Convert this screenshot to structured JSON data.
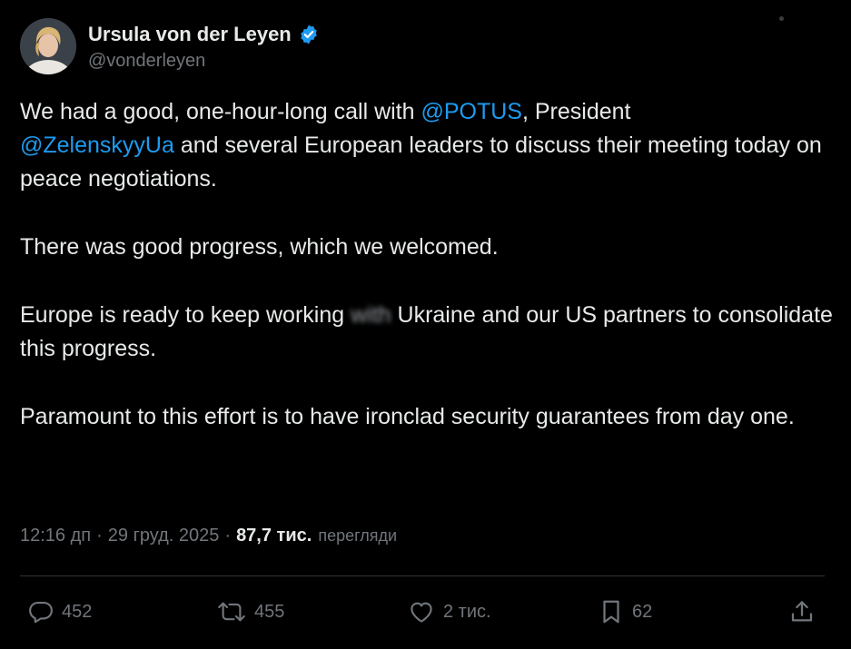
{
  "author": {
    "name": "Ursula von der Leyen",
    "handle": "@vonderleyen",
    "avatar": "avatar-photo",
    "verified_icon": "verified-badge-icon",
    "verified_color": "#1d9bf0"
  },
  "tweet": {
    "p1": {
      "t1": "We had a good, one-hour-long call with ",
      "m1": "@POTUS",
      "t2": ", President",
      "m2": "@ZelenskyyUa",
      "t3": " and several European leaders to discuss their meeting today on peace negotiations."
    },
    "p2": "There was good progress, which we welcomed.",
    "p3": {
      "t1": "Europe is ready to keep working ",
      "blurred": "with",
      "t2": " Ukraine and our US partners to consolidate this progress."
    },
    "p4": "Paramount to this effort is to have ironclad security guarantees from day one."
  },
  "meta": {
    "time": "12:16 дп",
    "separator": "·",
    "date": "29 груд. 2025",
    "views_count": "87,7 тис.",
    "views_label": "перегляди"
  },
  "actions": {
    "replies": "452",
    "reposts": "455",
    "likes": "2 тис.",
    "bookmarks": "62"
  },
  "colors": {
    "background": "#000000",
    "text": "#e7e9ea",
    "muted": "#71767b",
    "link": "#1d9bf0",
    "divider": "#2f3336"
  }
}
